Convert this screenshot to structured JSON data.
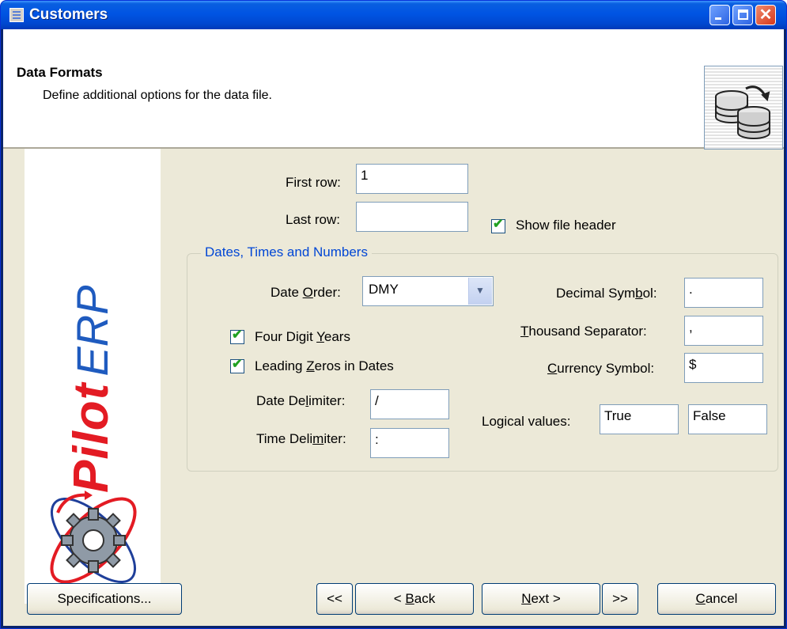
{
  "window": {
    "title": "Customers"
  },
  "header": {
    "title": "Data Formats",
    "subtitle": "Define additional options for the data file."
  },
  "sidebar": {
    "brand_bold": "Pilot",
    "brand_light": "ERP"
  },
  "rows": {
    "first_row_label": "First row:",
    "first_row_value": "1",
    "last_row_label": "Last row:",
    "last_row_value": "",
    "show_header_label": "Show file header",
    "show_header_checked": true
  },
  "dates_group": {
    "title": "Dates, Times and Numbers",
    "date_order_label_pre": "Date ",
    "date_order_label_u": "O",
    "date_order_label_post": "rder:",
    "date_order_value": "DMY",
    "four_digit_pre": "Four Digit ",
    "four_digit_u": "Y",
    "four_digit_post": "ears",
    "four_digit_checked": true,
    "leading_pre": "Leading ",
    "leading_u": "Z",
    "leading_post": "eros in Dates",
    "leading_checked": true,
    "date_delim_pre": "Date De",
    "date_delim_u": "l",
    "date_delim_post": "imiter:",
    "date_delim_value": "/",
    "time_delim_pre": "Time Deli",
    "time_delim_u": "m",
    "time_delim_post": "iter:",
    "time_delim_value": ":",
    "decimal_pre": "Decimal Sym",
    "decimal_u": "b",
    "decimal_post": "ol:",
    "decimal_value": ".",
    "thousand_u": "T",
    "thousand_post": "housand Separator:",
    "thousand_value": ",",
    "currency_u": "C",
    "currency_post": "urrency Symbol:",
    "currency_value": "$",
    "logical_label": "Logical values:",
    "logical_true": "True",
    "logical_false": "False"
  },
  "buttons": {
    "specifications": "Specifications...",
    "first": "<<",
    "back_pre": "< ",
    "back_u": "B",
    "back_post": "ack",
    "next_u": "N",
    "next_post": "ext >",
    "last": ">>",
    "cancel_u": "C",
    "cancel_post": "ancel"
  }
}
